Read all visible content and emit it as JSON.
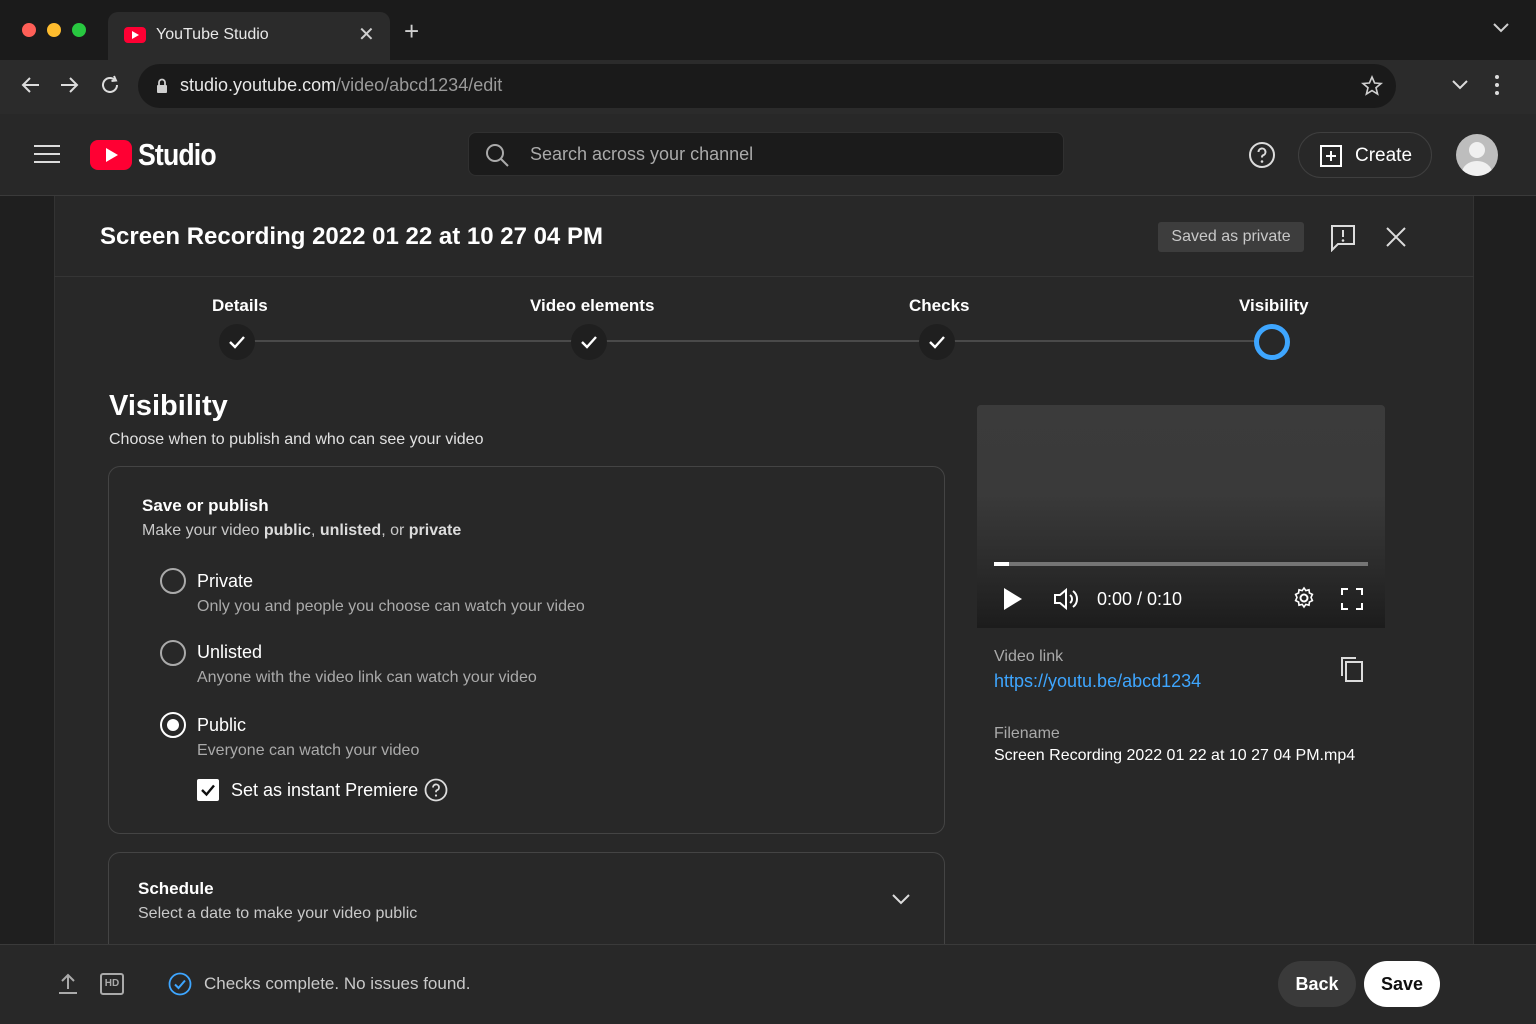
{
  "browser": {
    "tab_title": "YouTube Studio",
    "url_host": "studio.youtube.com",
    "url_path": "/video/abcd1234/edit"
  },
  "header": {
    "logo_text": "Studio",
    "search_placeholder": "Search across your channel",
    "create_label": "Create"
  },
  "dialog": {
    "title": "Screen Recording 2022 01 22 at 10 27 04 PM",
    "saved_badge": "Saved as private"
  },
  "stepper": {
    "steps": [
      {
        "label": "Details",
        "state": "done"
      },
      {
        "label": "Video elements",
        "state": "done"
      },
      {
        "label": "Checks",
        "state": "done"
      },
      {
        "label": "Visibility",
        "state": "current"
      }
    ]
  },
  "visibility": {
    "heading": "Visibility",
    "subtitle": "Choose when to publish and who can see your video",
    "save_publish": {
      "title": "Save or publish",
      "sub_prefix": "Make your video ",
      "sub_public": "public",
      "sub_comma": ", ",
      "sub_unlisted": "unlisted",
      "sub_or": ", or ",
      "sub_private": "private",
      "options": [
        {
          "label": "Private",
          "description": "Only you and people you choose can watch your video",
          "selected": false
        },
        {
          "label": "Unlisted",
          "description": "Anyone with the video link can watch your video",
          "selected": false
        },
        {
          "label": "Public",
          "description": "Everyone can watch your video",
          "selected": true
        }
      ],
      "premiere_label": "Set as instant Premiere",
      "premiere_checked": true
    },
    "schedule": {
      "title": "Schedule",
      "subtitle": "Select a date to make your video public"
    }
  },
  "preview": {
    "time": "0:00 / 0:10",
    "progress": 0.04,
    "video_link_label": "Video link",
    "video_link": "https://youtu.be/abcd1234",
    "filename_label": "Filename",
    "filename": "Screen Recording 2022 01 22 at 10 27 04 PM.mp4"
  },
  "footer": {
    "hd_badge": "HD",
    "checks_status": "Checks complete. No issues found.",
    "back_label": "Back",
    "save_label": "Save"
  },
  "colors": {
    "accent_blue": "#3ea6ff",
    "youtube_red": "#ff0033",
    "background": "#282828"
  }
}
